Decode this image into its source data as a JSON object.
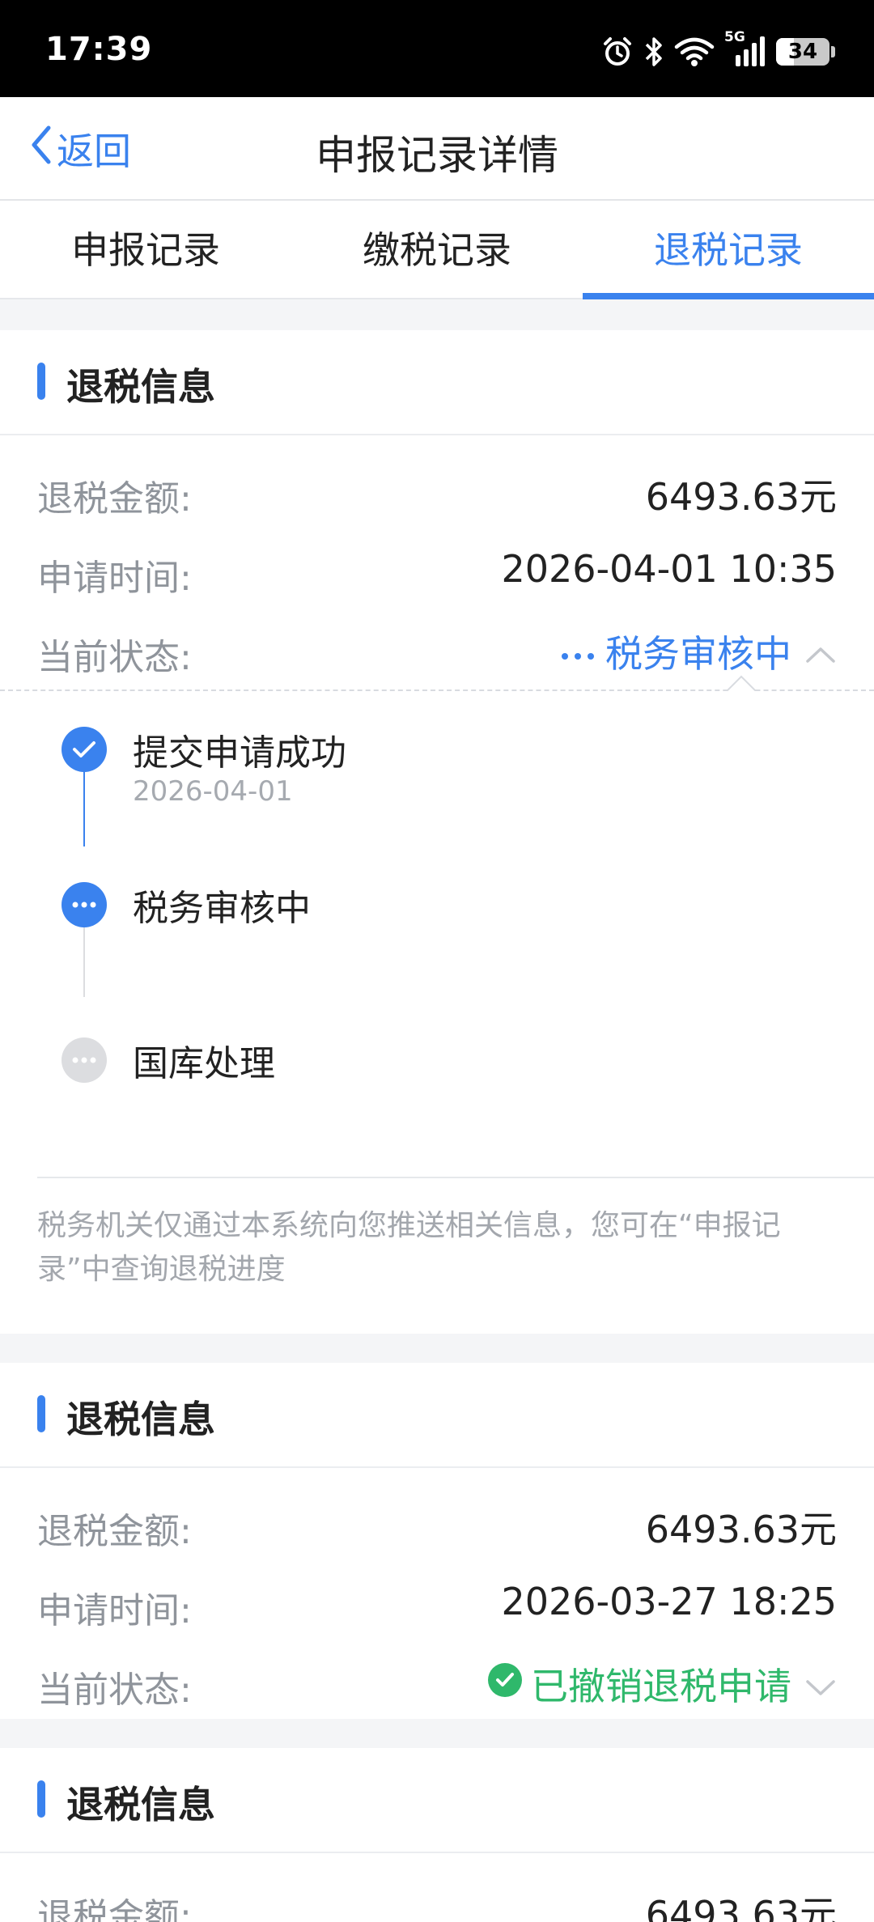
{
  "status_bar": {
    "time": "17:39",
    "battery": "34",
    "battery_level": 0.34,
    "network_label": "5G",
    "icons": [
      "alarm-icon",
      "bluetooth-icon",
      "wifi-icon",
      "signal-icon",
      "battery-icon"
    ]
  },
  "nav": {
    "back_label": "返回",
    "title": "申报记录详情"
  },
  "tabs": [
    {
      "label": "申报记录",
      "active": false
    },
    {
      "label": "缴税记录",
      "active": false
    },
    {
      "label": "退税记录",
      "active": true
    }
  ],
  "records": [
    {
      "title": "退税信息",
      "amount_label": "退税金额:",
      "amount": "6493.63元",
      "time_label": "申请时间:",
      "time": "2026-04-01 10:35",
      "status_label": "当前状态:",
      "status": "税务审核中",
      "status_color": "#3a82ee",
      "expanded": true,
      "timeline": [
        {
          "label": "提交申请成功",
          "date": "2026-04-01",
          "state": "done"
        },
        {
          "label": "税务审核中",
          "date": "",
          "state": "current"
        },
        {
          "label": "国库处理",
          "date": "",
          "state": "pending"
        }
      ],
      "note": "税务机关仅通过本系统向您推送相关信息，您可在“申报记录”中查询退税进度"
    },
    {
      "title": "退税信息",
      "amount_label": "退税金额:",
      "amount": "6493.63元",
      "time_label": "申请时间:",
      "time": "2026-03-27 18:25",
      "status_label": "当前状态:",
      "status": "已撤销退税申请",
      "status_color": "#2fb86b",
      "expanded": false
    },
    {
      "title": "退税信息",
      "amount_label": "退税金额:",
      "amount": "6493.63元"
    }
  ],
  "colors": {
    "accent": "#3a82ee",
    "success": "#2fb86b",
    "muted_text": "#8f949b",
    "background": "#f4f5f7"
  }
}
